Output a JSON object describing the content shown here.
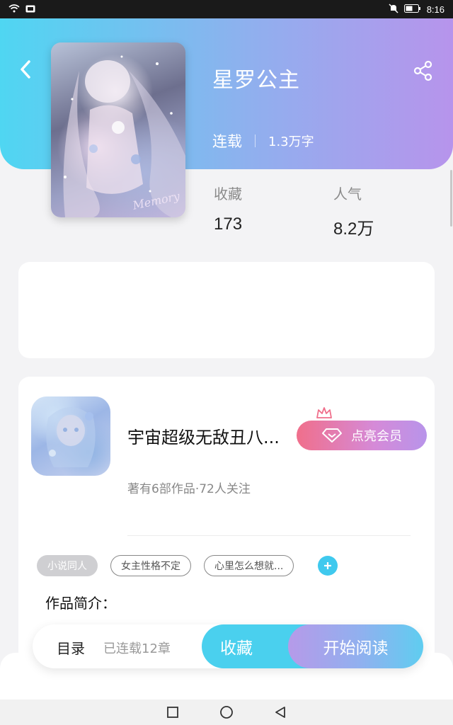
{
  "status_bar": {
    "time": "8:16",
    "icons": [
      "wifi-icon",
      "sim-icon",
      "mute-icon",
      "battery-icon"
    ]
  },
  "header": {
    "back_icon": "back-arrow-icon",
    "share_icon": "share-icon",
    "title": "星罗公主",
    "status": "连载",
    "word_count": "1.3万字",
    "gradient_colors": [
      "#4fd6f2",
      "#8fb0ee",
      "#b794ec"
    ]
  },
  "cover": {
    "signature": "Memory"
  },
  "stats": {
    "favorites_label": "收藏",
    "favorites_value": "173",
    "popularity_label": "人气",
    "popularity_value": "8.2万"
  },
  "author": {
    "name": "宇宙超级无敌丑八...",
    "subtitle": "著有6部作品·72人关注",
    "vip_label": "点亮会员"
  },
  "tags": [
    "小说同人",
    "女主性格不定",
    "心里怎么想就..."
  ],
  "intro_label": "作品简介：",
  "action_bar": {
    "toc_label": "目录",
    "toc_sub": "已连载12章",
    "collect_label": "收藏",
    "read_label": "开始阅读"
  },
  "nav_bar": {
    "icons": [
      "recent-apps-icon",
      "home-icon",
      "back-icon"
    ]
  }
}
